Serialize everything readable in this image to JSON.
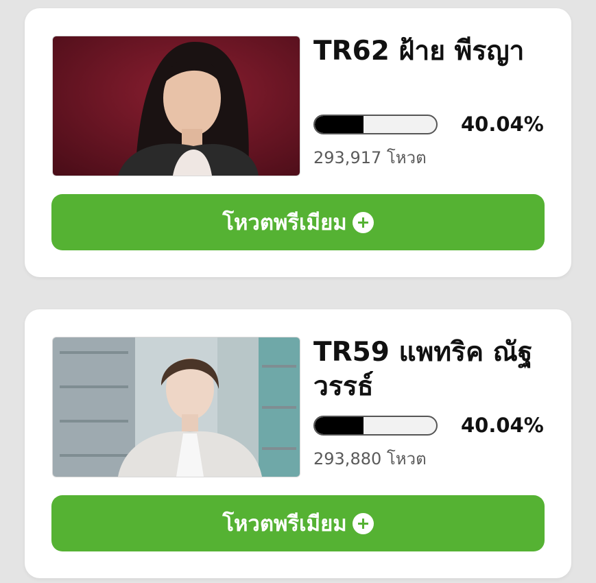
{
  "candidates": [
    {
      "name": "TR62 ฝ้าย พีรญา",
      "percent_label": "40.04%",
      "percent_value": 40.04,
      "votes_label": "293,917 โหวต",
      "button_label": "โหวตพรีเมียม",
      "button_icon": "plus-circle-icon"
    },
    {
      "name": "TR59 แพทริค ณัฐวรรธ์",
      "percent_label": "40.04%",
      "percent_value": 40.04,
      "votes_label": "293,880 โหวต",
      "button_label": "โหวตพรีเมียม",
      "button_icon": "plus-circle-icon"
    }
  ],
  "colors": {
    "accent_green": "#55b233",
    "progress_fill": "#000000",
    "progress_track": "#f2f2f2"
  }
}
